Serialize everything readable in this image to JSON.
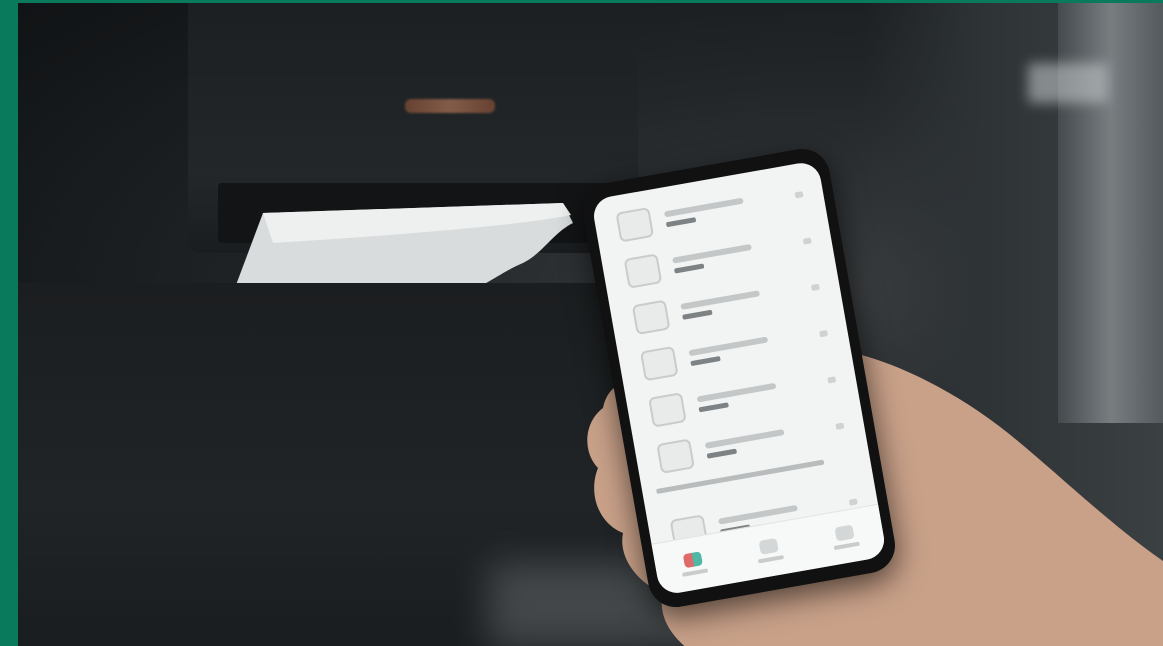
{
  "scene": {
    "frame_color": "#0a7a5d",
    "phone_screen_color": "#f2f3f3",
    "brand_accent": "#9c6a52"
  },
  "app": {
    "device_rows": 7,
    "tabs": [
      "home-tab",
      "devices-tab",
      "profile-tab"
    ],
    "active_tab": "home-tab"
  }
}
